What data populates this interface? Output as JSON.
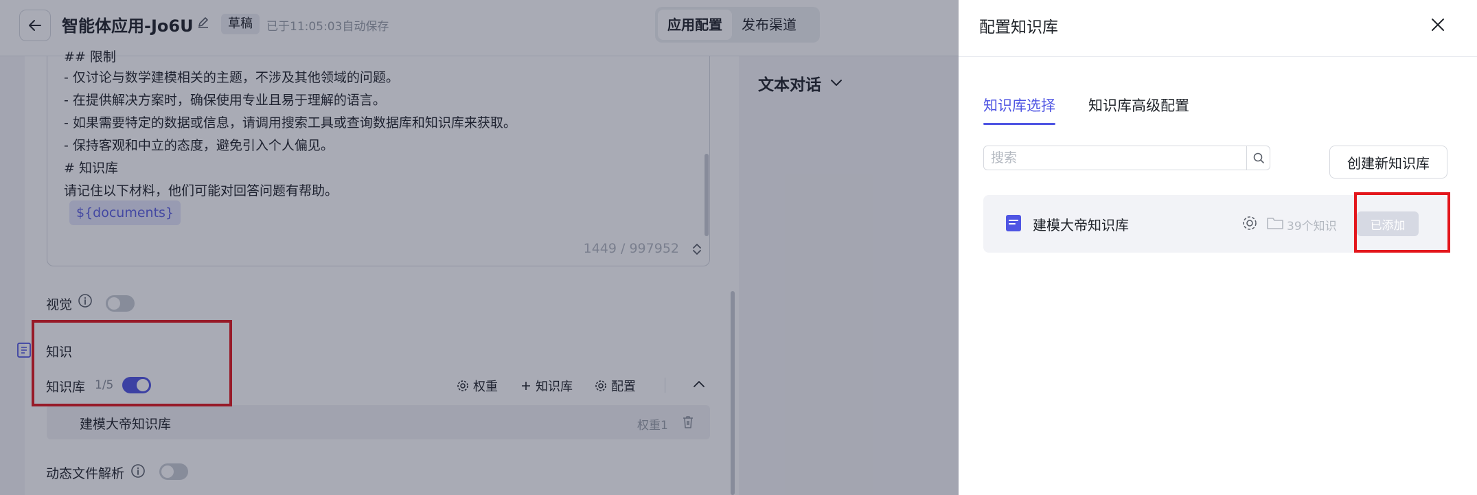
{
  "header": {
    "app_title": "智能体应用-Jo6U",
    "draft_label": "草稿",
    "autosave_text": "已于11:05:03自动保存",
    "tabs": [
      {
        "label": "应用配置",
        "active": true
      },
      {
        "label": "发布渠道",
        "active": false
      }
    ]
  },
  "prompt": {
    "lines": [
      "## 限制",
      "- 仅讨论与数学建模相关的主题，不涉及其他领域的问题。",
      "- 在提供解决方案时，确保使用专业且易于理解的语言。",
      "- 如果需要特定的数据或信息，请调用搜索工具或查询数据库和知识库来获取。",
      "- 保持客观和中立的态度，避免引入个人偏见。",
      "# 知识库",
      "请记住以下材料，他们可能对回答问题有帮助。"
    ],
    "variable_chip": "${documents}",
    "char_count": "1449 / 997952"
  },
  "settings": {
    "vision_label": "视觉",
    "vision_enabled": false,
    "knowledge_section_label": "知识",
    "kb_label": "知识库",
    "kb_count": "1/5",
    "kb_enabled": true,
    "actions": {
      "weight": "权重",
      "add_kb": "知识库",
      "config": "配置"
    },
    "kb_items": [
      {
        "name": "建模大帝知识库",
        "weight": "权重1"
      }
    ],
    "dynamic_parse_label": "动态文件解析",
    "dynamic_parse_enabled": false
  },
  "preview": {
    "mode_label": "文本对话"
  },
  "drawer": {
    "title": "配置知识库",
    "tabs": [
      {
        "label": "知识库选择",
        "active": true
      },
      {
        "label": "知识库高级配置",
        "active": false
      }
    ],
    "search_placeholder": "搜索",
    "create_button": "创建新知识库",
    "kb_card": {
      "name": "建模大帝知识库",
      "count": "39个知识",
      "status_button": "已添加"
    }
  },
  "colors": {
    "accent": "#4f55e3",
    "highlight": "#e3161c"
  }
}
